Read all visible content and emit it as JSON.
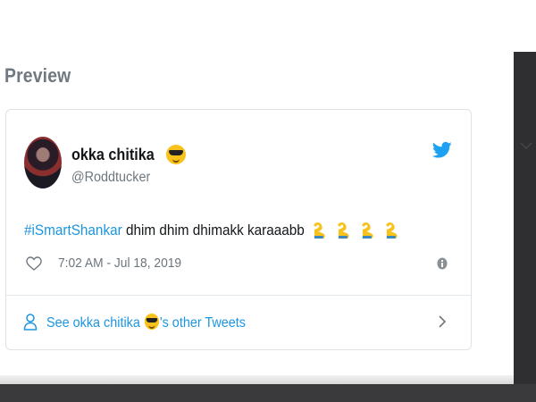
{
  "modal": {
    "heading": "Preview"
  },
  "tweet": {
    "user_name": "okka chitika",
    "handle": "@Roddtucker",
    "hashtag": "#iSmartShankar",
    "text": " dhim dhim dhimakk karaaabb",
    "timestamp": "7:02 AM - Jul 18, 2019",
    "other_tweets_prefix": "See okka chitika ",
    "other_tweets_suffix": "'s other Tweets"
  },
  "icons": {
    "brand": "twitter-bird-icon",
    "like": "heart-icon",
    "info": "info-icon",
    "profile": "person-icon",
    "next": "chevron-right-icon",
    "name_emoji": "smiling-face-with-sunglasses",
    "text_emoji": "rolling-on-the-floor-laughing",
    "text_emoji_count": 4
  },
  "colors": {
    "link": "#1b95e0",
    "text": "#14171a",
    "muted": "#6e767d",
    "heading": "#707980",
    "overlay": "#2f2f31"
  }
}
